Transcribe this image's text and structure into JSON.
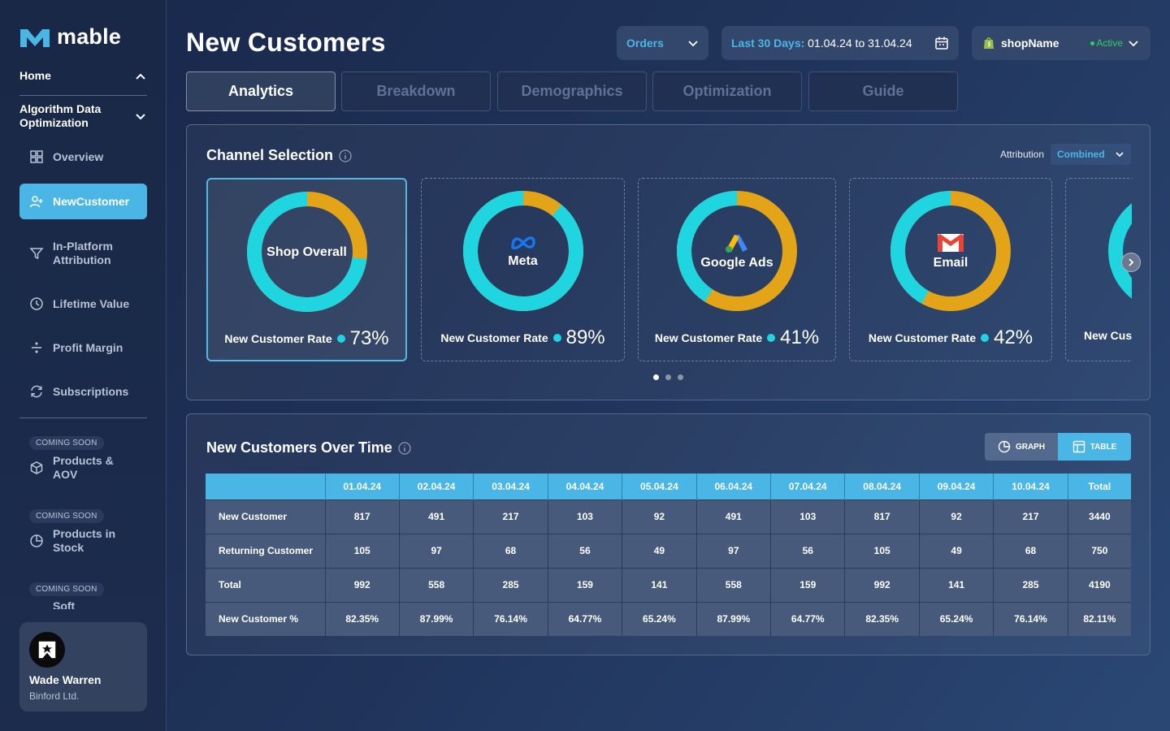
{
  "brand": {
    "name": "mable",
    "accent": "#4ab6e6",
    "donut_cyan": "#1fd5e0",
    "donut_gold": "#e3a417"
  },
  "sidebar": {
    "home_label": "Home",
    "section_label": "Algorithm Data Optimization",
    "items": [
      {
        "label": "Overview",
        "icon": "grid-icon"
      },
      {
        "label": "NewCustomer",
        "icon": "add-user-icon",
        "active": true
      },
      {
        "label": "In-Platform Attribution",
        "icon": "filter-icon"
      },
      {
        "label": "Lifetime Value",
        "icon": "clock-icon"
      },
      {
        "label": "Profit Margin",
        "icon": "divide-icon"
      },
      {
        "label": "Subscriptions",
        "icon": "refresh-icon"
      }
    ],
    "coming_soon": [
      {
        "badge": "COMING SOON",
        "label": "Products & AOV",
        "icon": "box-icon"
      },
      {
        "badge": "COMING SOON",
        "label": "Products in Stock",
        "icon": "pie-icon"
      },
      {
        "badge": "COMING SOON",
        "label": "Soft"
      }
    ],
    "user": {
      "name": "Wade Warren",
      "company": "Binford Ltd."
    }
  },
  "header": {
    "title": "New Customers",
    "metric_select": "Orders",
    "date_label": "Last 30 Days:",
    "date_range": "01.04.24 to 31.04.24",
    "shop_name": "shopName",
    "shop_status": "Active"
  },
  "tabs": [
    "Analytics",
    "Breakdown",
    "Demographics",
    "Optimization",
    "Guide"
  ],
  "channel_selection": {
    "title": "Channel Selection",
    "attribution_label": "Attribution",
    "attribution_value": "Combined",
    "rate_label": "New Customer Rate",
    "partial_label": "New Cus",
    "cards": [
      {
        "name": "Shop Overall",
        "rate": "73%",
        "rate_value": 73,
        "selected": true
      },
      {
        "name": "Meta",
        "rate": "89%",
        "rate_value": 89,
        "icon": "meta-icon"
      },
      {
        "name": "Google Ads",
        "rate": "41%",
        "rate_value": 41,
        "icon": "google-ads-icon"
      },
      {
        "name": "Email",
        "rate": "42%",
        "rate_value": 42,
        "icon": "gmail-icon"
      }
    ]
  },
  "over_time": {
    "title": "New Customers Over Time",
    "graph_label": "GRAPH",
    "table_label": "TABLE",
    "columns": [
      "",
      "01.04.24",
      "02.04.24",
      "03.04.24",
      "04.04.24",
      "05.04.24",
      "06.04.24",
      "07.04.24",
      "08.04.24",
      "09.04.24",
      "10.04.24",
      "Total"
    ],
    "rows": [
      [
        "New Customer",
        "817",
        "491",
        "217",
        "103",
        "92",
        "491",
        "103",
        "817",
        "92",
        "217",
        "3440"
      ],
      [
        "Returning Customer",
        "105",
        "97",
        "68",
        "56",
        "49",
        "97",
        "56",
        "105",
        "49",
        "68",
        "750"
      ],
      [
        "Total",
        "992",
        "558",
        "285",
        "159",
        "141",
        "558",
        "159",
        "992",
        "141",
        "285",
        "4190"
      ],
      [
        "New Customer %",
        "82.35%",
        "87.99%",
        "76.14%",
        "64.77%",
        "65.24%",
        "87.99%",
        "64.77%",
        "82.35%",
        "65.24%",
        "76.14%",
        "82.11%"
      ]
    ]
  }
}
